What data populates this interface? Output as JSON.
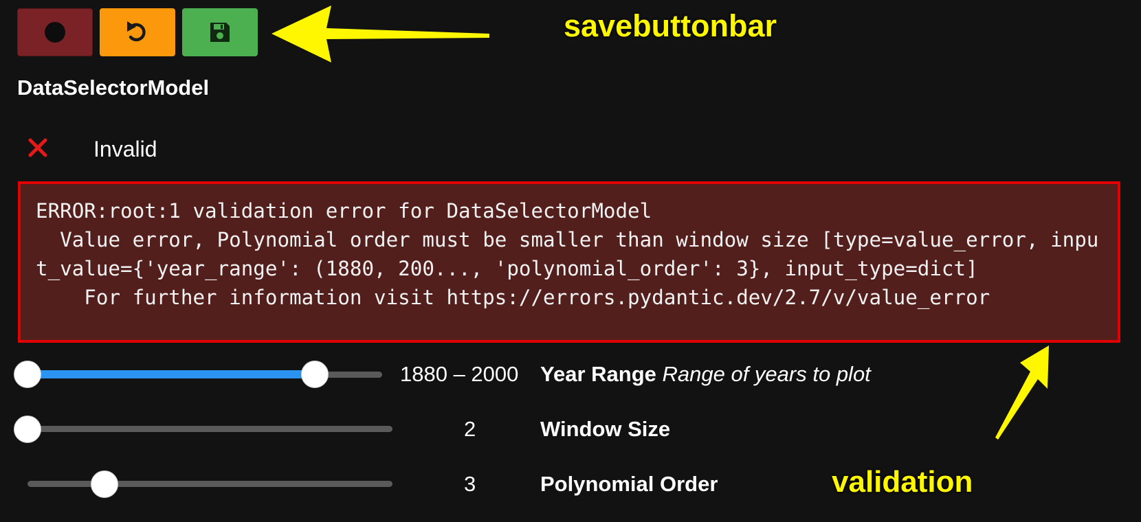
{
  "toolbar": {
    "record_icon": "record-dot-icon",
    "reset_icon": "undo-icon",
    "save_icon": "floppy-disk-icon",
    "colors": {
      "record": "#7b2226",
      "reset": "#fb980c",
      "save": "#4caf50"
    }
  },
  "annotations": {
    "savebuttonbar": "savebuttonbar",
    "validation": "validation",
    "color": "#fff700"
  },
  "model": {
    "title": "DataSelectorModel",
    "status_icon": "x-mark-icon",
    "status_label": "Invalid",
    "error_text": "ERROR:root:1 validation error for DataSelectorModel\n  Value error, Polynomial order must be smaller than window size [type=value_error, input_value={'year_range': (1880, 200..., 'polynomial_order': 3}, input_type=dict]\n    For further information visit https://errors.pydantic.dev/2.7/v/value_error"
  },
  "params": {
    "year_range": {
      "value_text": "1880 – 2000",
      "name": "Year Range",
      "description": "Range of years to plot",
      "low_fraction": 0.0,
      "high_fraction": 0.86
    },
    "window_size": {
      "value_text": "2",
      "name": "Window Size",
      "fraction": 0.0
    },
    "polynomial_order": {
      "value_text": "3",
      "name": "Polynomial Order",
      "fraction": 0.22
    }
  }
}
